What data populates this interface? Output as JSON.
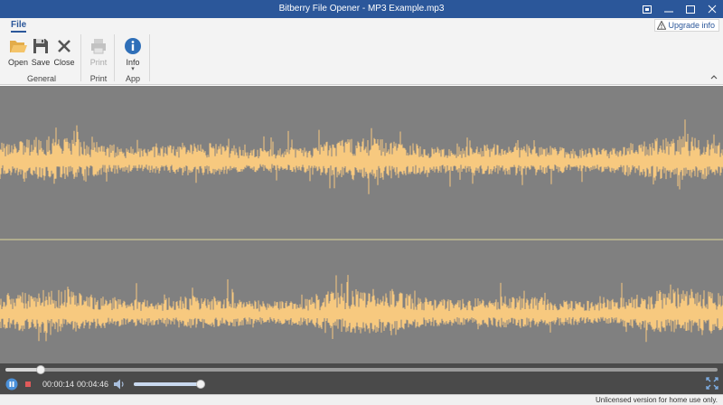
{
  "window": {
    "title": "Bitberry File Opener - MP3 Example.mp3",
    "controls": [
      "pin-icon",
      "minimize-icon",
      "maximize-icon",
      "close-icon"
    ]
  },
  "menu": {
    "file_tab": "File",
    "upgrade_label": "Upgrade info"
  },
  "ribbon": {
    "groups": [
      {
        "label": "General",
        "buttons": [
          {
            "label": "Open",
            "icon": "folder-open-icon",
            "enabled": true
          },
          {
            "label": "Save",
            "icon": "floppy-disk-icon",
            "enabled": true
          },
          {
            "label": "Close",
            "icon": "close-x-icon",
            "enabled": true
          }
        ]
      },
      {
        "label": "Print",
        "buttons": [
          {
            "label": "Print",
            "icon": "printer-icon",
            "enabled": false
          }
        ]
      },
      {
        "label": "App",
        "buttons": [
          {
            "label": "Info",
            "icon": "info-icon",
            "enabled": true,
            "dropdown": true
          }
        ]
      }
    ]
  },
  "waveform": {
    "channels": 2,
    "background": "#808080",
    "wave_color": "#f7c97f",
    "divider_color": "#e0d89a"
  },
  "player": {
    "current_time": "00:00:14",
    "total_time": "00:04:46",
    "progress": 0.05,
    "volume": 0.97,
    "accent": "#4a90d9",
    "stop_color": "#e05a5a"
  },
  "status": {
    "message": "Unlicensed version for home use only."
  },
  "colors": {
    "titlebar": "#2b579a",
    "ribbon": "#f3f3f3"
  }
}
